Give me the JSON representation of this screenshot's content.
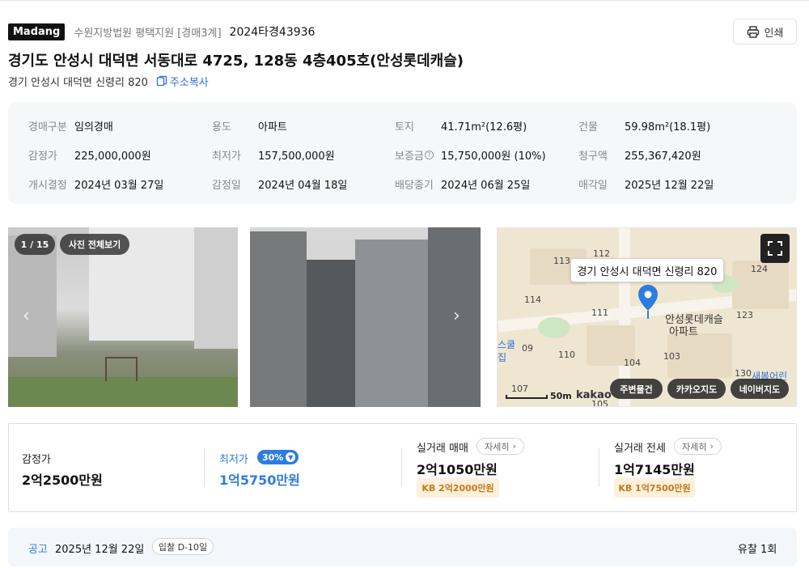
{
  "header": {
    "logo": "Madang",
    "court": "수원지방법원 평택지원 [경매3계]",
    "case_number": "2024타경43936",
    "print_label": "인쇄"
  },
  "property": {
    "title": "경기도 안성시 대덕면 서동대로 4725, 128동 4층405호(안성롯데캐슬)",
    "lot_address": "경기 안성시 대덕면 신령리 820",
    "copy_label": "주소복사"
  },
  "info": {
    "rows": [
      [
        {
          "key": "경매구분",
          "value": "임의경매"
        },
        {
          "key": "용도",
          "value": "아파트"
        },
        {
          "key": "토지",
          "value": "41.71m²(12.6평)"
        },
        {
          "key": "건물",
          "value": "59.98m²(18.1평)"
        }
      ],
      [
        {
          "key": "감정가",
          "value": "225,000,000원"
        },
        {
          "key": "최저가",
          "value": "157,500,000원"
        },
        {
          "key": "보증금",
          "value": "15,750,000원 (10%)"
        },
        {
          "key": "청구액",
          "value": "255,367,420원"
        }
      ],
      [
        {
          "key": "개시결정",
          "value": "2024년 03월 27일"
        },
        {
          "key": "감정일",
          "value": "2024년 04월 18일"
        },
        {
          "key": "배당종기",
          "value": "2024년 06월 25일"
        },
        {
          "key": "매각일",
          "value": "2025년 12월 22일"
        }
      ]
    ],
    "help_mark": "?"
  },
  "photos": {
    "counter": "1 / 15",
    "view_all": "사진 전체보기"
  },
  "map": {
    "tooltip": "경기 안성시 대덕면 신령리 820",
    "complex_name_1": "안성롯데캐슬",
    "complex_name_2": "아파트",
    "labels": [
      "112",
      "113",
      "124",
      "114",
      "111",
      "123",
      "110",
      "104",
      "103",
      "130",
      "107",
      "105",
      "09"
    ],
    "scale": "50m",
    "brand": "kakao",
    "edge_text_1": "스쿨",
    "edge_text_2": "집",
    "edge_text_3": "새봄어린이",
    "buttons": [
      "주변물건",
      "카카오지도",
      "네이버지도"
    ]
  },
  "prices": {
    "appraisal_label": "감정가",
    "appraisal_value": "2억2500만원",
    "minimum_label": "최저가",
    "minimum_badge": "30%",
    "minimum_value": "1억5750만원",
    "trade_label": "실거래 매매",
    "trade_value": "2억1050만원",
    "trade_kb": "KB 2억2000만원",
    "jeonse_label": "실거래 전세",
    "jeonse_value": "1억7145만원",
    "jeonse_kb": "KB 1억7500만원",
    "detail_label": "자세히"
  },
  "notice": {
    "label": "공고",
    "date": "2025년 12월 22일",
    "dday": "입찰 D-10일",
    "fail_count": "유찰 1회"
  },
  "colors": {
    "accent": "#2f7ce0",
    "kb_bg": "#fdf1dd",
    "kb_text": "#c7781a"
  }
}
